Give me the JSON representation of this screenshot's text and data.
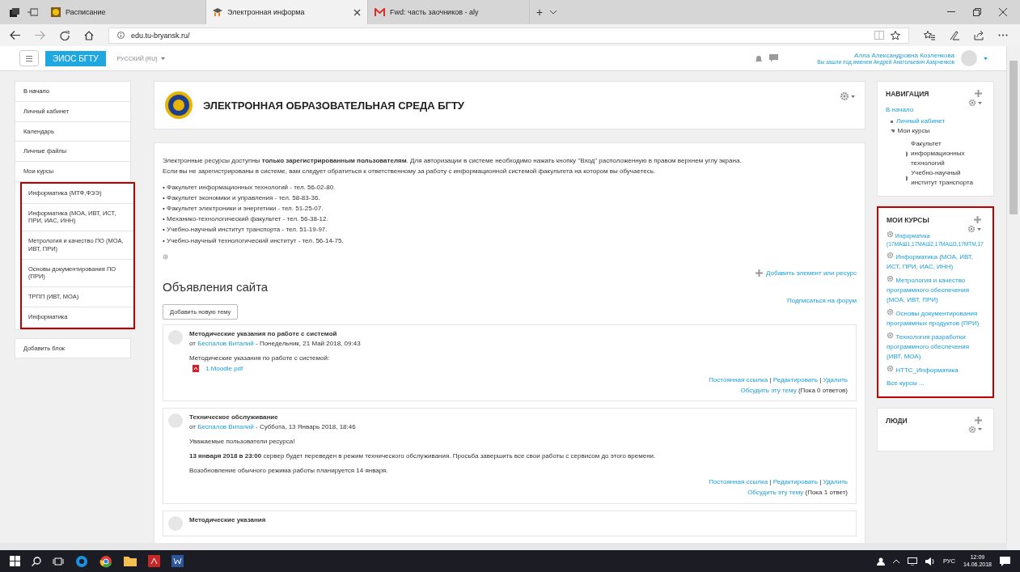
{
  "browser": {
    "tabs": [
      {
        "title": "Расписание",
        "selected": false,
        "kind": "calendar"
      },
      {
        "title": "Электронная информа",
        "selected": true,
        "kind": "moodle",
        "closable": true
      },
      {
        "title": "Fwd: часть заочников - aly",
        "selected": false,
        "kind": "mail"
      }
    ],
    "new_tab": "+",
    "url": "edu.tu-bryansk.ru/"
  },
  "navbar": {
    "brand": "ЭИОС БГТУ",
    "language": "РУССКИЙ (RU)",
    "user_name": "Алла Александровна Козленкова",
    "login_as": "Вы зашли под именем Андрей Анатольевич Азарченков"
  },
  "sidebar": {
    "items": [
      {
        "label": "В начало",
        "kind": "home"
      },
      {
        "label": "Личный кабинет",
        "kind": "link"
      },
      {
        "label": "Календарь",
        "kind": "link"
      },
      {
        "label": "Личные файлы",
        "kind": "link"
      },
      {
        "label": "Мои курсы",
        "kind": "link"
      }
    ],
    "courses_highlighted": true,
    "courses": [
      "Информатика (МТФ,ФЭЭ)",
      "Информатика (МОА, ИВТ, ИСТ, ПРИ, ИАС, ИНН)",
      "Метрология и качество ПО (МОА, ИВТ, ПРИ)",
      "Основы документирования ПО (ПРИ)",
      "ТРПП (ИВТ, МОА)",
      "Информатика"
    ],
    "add_block": "Добавить блок"
  },
  "header": {
    "title": "ЭЛЕКТРОННАЯ ОБРАЗОВАТЕЛЬНАЯ СРЕДА БГТУ"
  },
  "intro": {
    "paragraphs": [
      "Электронные ресурсы доступны **только зарегистрированным пользователям**. Для авторизации в системе необходимо нажать кнопку \"Вход\" расположенную в правом верхнем углу экрана.",
      "Если вы не зарегистрированы в системе, вам следует обратиться к ответственному за работу с информационной системой факультета на котором вы обучаетесь."
    ],
    "bullet": "•",
    "contacts": [
      "Факультет информационных технологий - тел. 56-02-80.",
      "Факультет экономики и управления - тел. 58-83-36.",
      "Факультет электроники и энергетики - тел. 51-25-07.",
      "Механико-технологический факультет - тел. 56-38-12.",
      "Учебно-научный институт транспорта - тел. 51-19-97.",
      "Учебно-научный технологический институт - тел. 56-14-75."
    ]
  },
  "add_resource": "Добавить элемент или ресурс",
  "forum": {
    "title": "Объявления сайта",
    "subscribe": "Подписаться на форум",
    "new_topic": "Добавить новую тему",
    "separator": "|",
    "posts": [
      {
        "title": "Методические указания по работе с системой",
        "by": "от",
        "author": "Беспалов Виталий",
        "date": "- Понедельник, 21 Май 2018, 09:43",
        "body": [
          "Методические указания по работе с системой:"
        ],
        "attachment": "1.Moodle.pdf",
        "links": [
          "Постоянная ссылка",
          "Редактировать",
          "Удалить"
        ],
        "discuss": "Обсудить эту тему",
        "replies": "(Пока 0 ответов)"
      },
      {
        "title": "Техническое обслуживание",
        "by": "от",
        "author": "Беспалов Виталий",
        "date": "- Суббота, 13 Январь 2018, 18:46",
        "body": [
          "Уважаемые пользователи ресурса!",
          "**13 января 2018 в 23:00** сервер будет переведен в режим технического обслуживания. Просьба завершить все свои работы с сервисом до этого времени.",
          "Возобновление обычного режима работы планируется 14 января."
        ],
        "links": [
          "Постоянная ссылка",
          "Редактировать",
          "Удалить"
        ],
        "discuss": "Обсудить эту тему",
        "replies": "(Пока 1 ответ)"
      },
      {
        "title": "Методические указания"
      }
    ]
  },
  "navigation": {
    "title": "НАВИГАЦИЯ",
    "home": "В начало",
    "items": [
      {
        "label": "Личный кабинет",
        "kind": "link"
      },
      {
        "label": "Мои курсы",
        "kind": "expanded",
        "children": [
          {
            "label": "Факультет информационных технологий",
            "kind": "collapsed"
          },
          {
            "label": "Учебно-научный институт транспорта",
            "kind": "collapsed"
          }
        ]
      }
    ]
  },
  "my_courses": {
    "title": "МОИ КУРСЫ",
    "highlighted": true,
    "courses": [
      "Информатика (17МАШ1,17МАШ2,17МАШ3,17МТМ,17",
      "Информатика (МОА, ИВТ, ИСТ, ПРИ, ИАС, ИНН)",
      "Метрология и качество программного обеспечения (МОА, ИВТ, ПРИ)",
      "Основы документирования программных продуктов (ПРИ)",
      "Технология разработки программного обеспечения (ИВТ, МОА)",
      "НТТС_Информатика"
    ],
    "all": "Все курсы ..."
  },
  "people": {
    "title": "ЛЮДИ"
  },
  "taskbar": {
    "language": "РУС",
    "time": "12:09",
    "date": "14.06.2018"
  }
}
